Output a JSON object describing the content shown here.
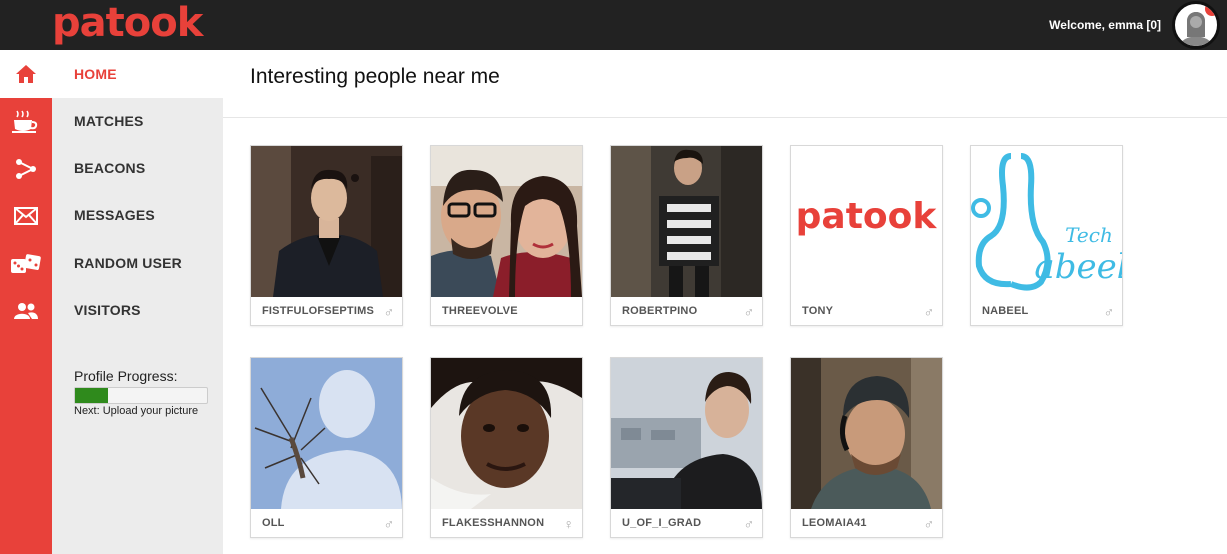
{
  "header": {
    "logo": "patook",
    "welcome": "Welcome, emma [0]"
  },
  "colors": {
    "brand": "#e8413a",
    "topbar": "#222222",
    "progress": "#2f8a1c"
  },
  "rail_icons": [
    "home-icon",
    "coffee-icon",
    "share-icon",
    "mail-icon",
    "dice-icon",
    "users-icon"
  ],
  "nav": {
    "items": [
      {
        "label": "HOME"
      },
      {
        "label": "MATCHES"
      },
      {
        "label": "BEACONS"
      },
      {
        "label": "MESSAGES"
      },
      {
        "label": "RANDOM USER"
      },
      {
        "label": "VISITORS"
      }
    ],
    "progress_title": "Profile Progress:",
    "progress_fraction": 0.25,
    "progress_next": "Next: Upload your picture"
  },
  "main": {
    "title": "Interesting people near me",
    "people": [
      {
        "name": "FISTFULOFSEPTIMS",
        "gender": "♂"
      },
      {
        "name": "THREEVOLVE",
        "gender": ""
      },
      {
        "name": "ROBERTPINO",
        "gender": "♂"
      },
      {
        "name": "TONY",
        "gender": "♂"
      },
      {
        "name": "NABEEL",
        "gender": "♂"
      },
      {
        "name": "OLL",
        "gender": "♂"
      },
      {
        "name": "FLAKESSHANNON",
        "gender": "♀"
      },
      {
        "name": "U_OF_I_GRAD",
        "gender": "♂"
      },
      {
        "name": "LEOMAIA41",
        "gender": "♂"
      }
    ],
    "logo_card_text": "patook",
    "tech_card_text": "Tech",
    "tech_card_script": "abeel"
  }
}
